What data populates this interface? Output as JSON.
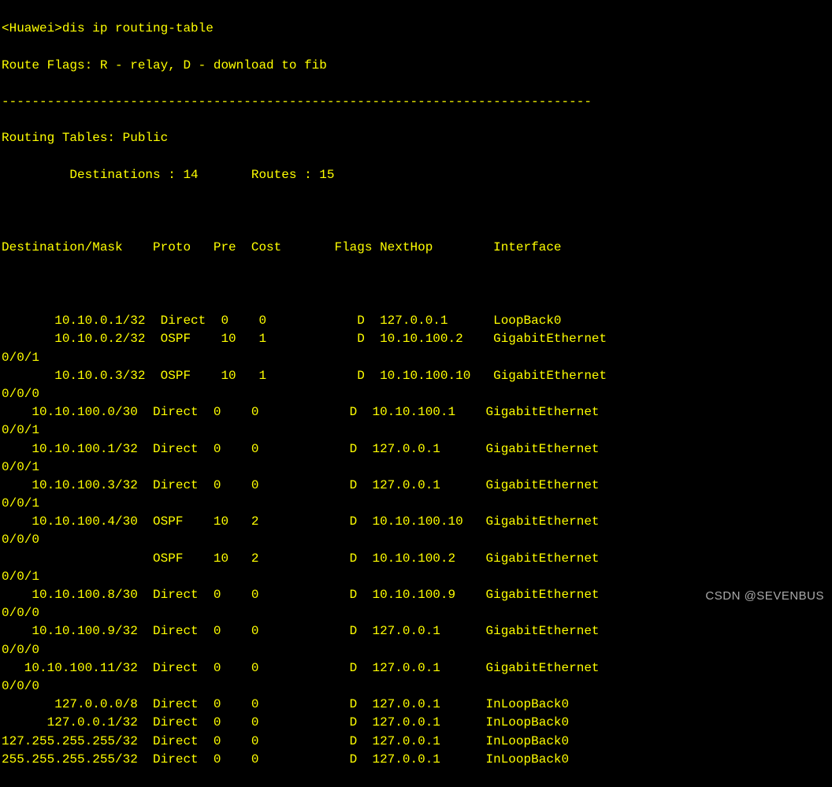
{
  "prompt_prefix": "<Huawei>",
  "command": "dis ip routing-table",
  "flags_line": "Route Flags: R - relay, D - download to fib",
  "separator": "------------------------------------------------------------------------------",
  "tables_header": "Routing Tables: Public",
  "counts_line": "         Destinations : 14       Routes : 15",
  "columns": {
    "dest": "Destination/Mask",
    "proto": "Proto",
    "pre": "Pre",
    "cost": "Cost",
    "flags": "Flags",
    "nexthop": "NextHop",
    "iface": "Interface"
  },
  "rows": [
    {
      "dl": "       10.10.0.1/32",
      "proto": "Direct",
      "pre": "0",
      "cost": "0",
      "flags": "D",
      "nexthop": "127.0.0.1",
      "iface": "LoopBack0",
      "wrap": ""
    },
    {
      "dl": "       10.10.0.2/32",
      "proto": "OSPF",
      "pre": "10",
      "cost": "1",
      "flags": "D",
      "nexthop": "10.10.100.2",
      "iface": "GigabitEthernet",
      "wrap": "0/0/1"
    },
    {
      "dl": "       10.10.0.3/32",
      "proto": "OSPF",
      "pre": "10",
      "cost": "1",
      "flags": "D",
      "nexthop": "10.10.100.10",
      "iface": "GigabitEthernet",
      "wrap": "0/0/0"
    },
    {
      "dl": "    10.10.100.0/30",
      "proto": "Direct",
      "pre": "0",
      "cost": "0",
      "flags": "D",
      "nexthop": "10.10.100.1",
      "iface": "GigabitEthernet",
      "wrap": "0/0/1"
    },
    {
      "dl": "    10.10.100.1/32",
      "proto": "Direct",
      "pre": "0",
      "cost": "0",
      "flags": "D",
      "nexthop": "127.0.0.1",
      "iface": "GigabitEthernet",
      "wrap": "0/0/1"
    },
    {
      "dl": "    10.10.100.3/32",
      "proto": "Direct",
      "pre": "0",
      "cost": "0",
      "flags": "D",
      "nexthop": "127.0.0.1",
      "iface": "GigabitEthernet",
      "wrap": "0/0/1"
    },
    {
      "dl": "    10.10.100.4/30",
      "proto": "OSPF",
      "pre": "10",
      "cost": "2",
      "flags": "D",
      "nexthop": "10.10.100.10",
      "iface": "GigabitEthernet",
      "wrap": "0/0/0"
    },
    {
      "dl": "",
      "proto": "OSPF",
      "pre": "10",
      "cost": "2",
      "flags": "D",
      "nexthop": "10.10.100.2",
      "iface": "GigabitEthernet",
      "wrap": "0/0/1"
    },
    {
      "dl": "    10.10.100.8/30",
      "proto": "Direct",
      "pre": "0",
      "cost": "0",
      "flags": "D",
      "nexthop": "10.10.100.9",
      "iface": "GigabitEthernet",
      "wrap": "0/0/0"
    },
    {
      "dl": "    10.10.100.9/32",
      "proto": "Direct",
      "pre": "0",
      "cost": "0",
      "flags": "D",
      "nexthop": "127.0.0.1",
      "iface": "GigabitEthernet",
      "wrap": "0/0/0"
    },
    {
      "dl": "   10.10.100.11/32",
      "proto": "Direct",
      "pre": "0",
      "cost": "0",
      "flags": "D",
      "nexthop": "127.0.0.1",
      "iface": "GigabitEthernet",
      "wrap": "0/0/0"
    },
    {
      "dl": "       127.0.0.0/8",
      "proto": "Direct",
      "pre": "0",
      "cost": "0",
      "flags": "D",
      "nexthop": "127.0.0.1",
      "iface": "InLoopBack0",
      "wrap": ""
    },
    {
      "dl": "      127.0.0.1/32",
      "proto": "Direct",
      "pre": "0",
      "cost": "0",
      "flags": "D",
      "nexthop": "127.0.0.1",
      "iface": "InLoopBack0",
      "wrap": ""
    },
    {
      "dl": "127.255.255.255/32",
      "proto": "Direct",
      "pre": "0",
      "cost": "0",
      "flags": "D",
      "nexthop": "127.0.0.1",
      "iface": "InLoopBack0",
      "wrap": ""
    },
    {
      "dl": "255.255.255.255/32",
      "proto": "Direct",
      "pre": "0",
      "cost": "0",
      "flags": "D",
      "nexthop": "127.0.0.1",
      "iface": "InLoopBack0",
      "wrap": ""
    }
  ],
  "watermark": "CSDN @SEVENBUS"
}
